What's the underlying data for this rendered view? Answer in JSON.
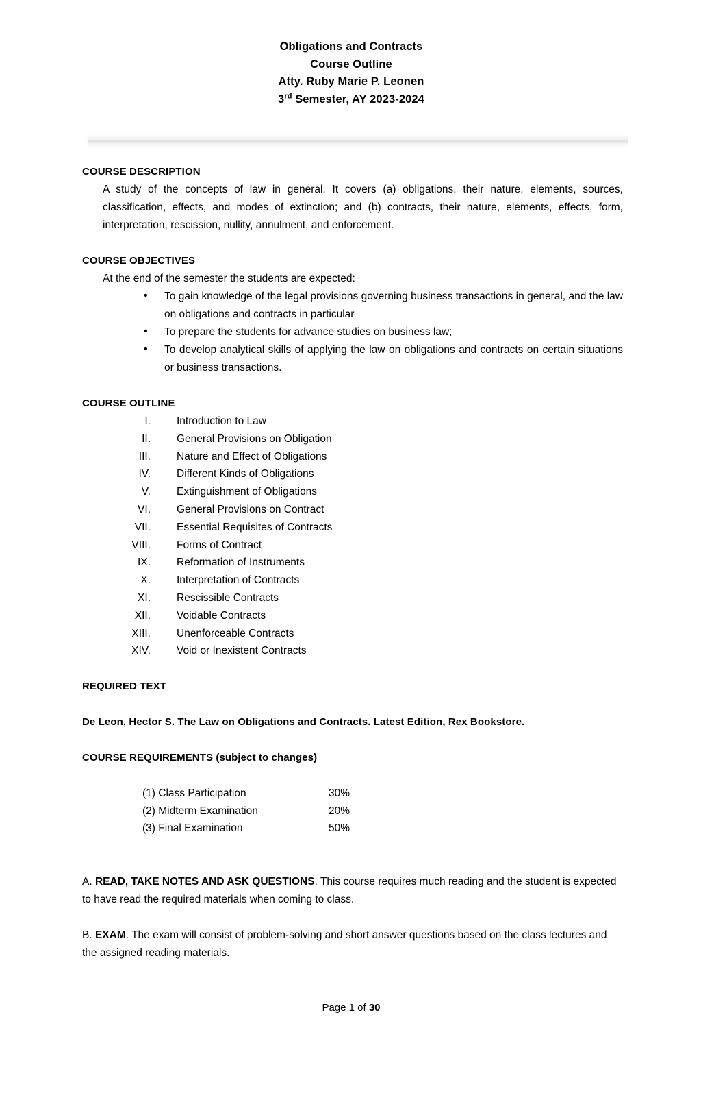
{
  "header": {
    "line1": "Obligations and Contracts",
    "line2": "Course Outline",
    "line3": "Atty. Ruby Marie P. Leonen",
    "line4_prefix": "3",
    "line4_sup": "rd",
    "line4_suffix": " Semester, AY 2023-2024"
  },
  "course_description": {
    "heading": "COURSE DESCRIPTION",
    "body": "A study of the concepts of law in general. It covers (a) obligations, their nature, elements, sources, classification, effects, and modes of extinction; and (b) contracts, their nature, elements, effects, form, interpretation, rescission, nullity, annulment, and enforcement."
  },
  "course_objectives": {
    "heading": "COURSE OBJECTIVES",
    "intro": "At the end of the semester the students are expected:",
    "bullets": [
      "To gain knowledge of the legal provisions governing business transactions in general, and the law on obligations and contracts in particular",
      "To prepare the students for advance studies on business law;",
      "To develop analytical skills of applying the law on obligations and contracts on certain situations or business transactions."
    ]
  },
  "course_outline": {
    "heading": "COURSE OUTLINE",
    "items": [
      {
        "num": "I.",
        "label": "Introduction to Law"
      },
      {
        "num": "II.",
        "label": "General Provisions on Obligation"
      },
      {
        "num": "III.",
        "label": "Nature and Effect of Obligations"
      },
      {
        "num": "IV.",
        "label": "Different Kinds of Obligations"
      },
      {
        "num": "V.",
        "label": "Extinguishment of Obligations"
      },
      {
        "num": "VI.",
        "label": "General Provisions on Contract"
      },
      {
        "num": "VII.",
        "label": "Essential Requisites of Contracts"
      },
      {
        "num": "VIII.",
        "label": "Forms of Contract"
      },
      {
        "num": "IX.",
        "label": "Reformation of Instruments"
      },
      {
        "num": "X.",
        "label": "Interpretation of Contracts"
      },
      {
        "num": "XI.",
        "label": "Rescissible Contracts"
      },
      {
        "num": "XII.",
        "label": "Voidable Contracts"
      },
      {
        "num": "XIII.",
        "label": "Unenforceable Contracts"
      },
      {
        "num": "XIV.",
        "label": "Void or Inexistent Contracts"
      }
    ]
  },
  "required_text": {
    "heading": "REQUIRED TEXT",
    "citation": "De Leon, Hector S. The Law on Obligations and Contracts. Latest Edition, Rex Bookstore."
  },
  "course_requirements": {
    "heading": "COURSE REQUIREMENTS (subject to changes)",
    "rows": [
      {
        "item": "(1) Class Participation",
        "percent": "30%"
      },
      {
        "item": "(2) Midterm Examination",
        "percent": "20%"
      },
      {
        "item": "(3) Final Examination",
        "percent": "50%"
      }
    ]
  },
  "notes": {
    "a_prefix": "A. ",
    "a_bold": "READ, TAKE NOTES AND ASK QUESTIONS",
    "a_rest": ". This course requires much reading and the student is expected to have read the required materials when coming to class.",
    "b_prefix": "B. ",
    "b_bold": "EXAM",
    "b_rest": ". The exam will consist of problem-solving and short answer questions based on the class lectures and the assigned reading materials."
  },
  "footer": {
    "prefix": "Page 1 of ",
    "total": "30"
  }
}
